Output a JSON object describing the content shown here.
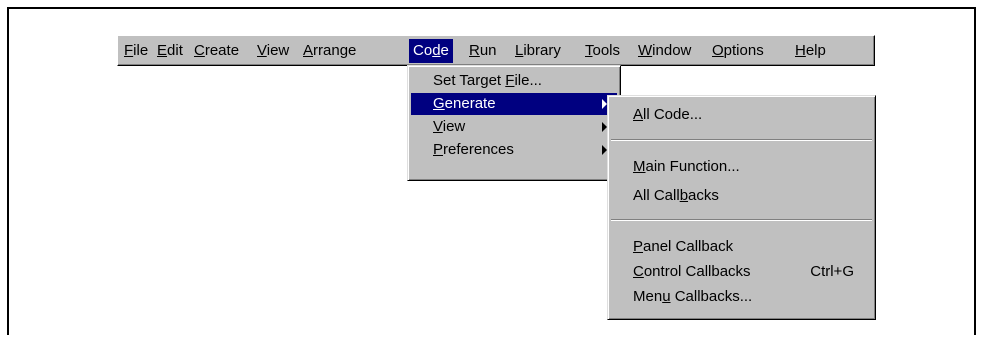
{
  "menubar": {
    "items": [
      {
        "pre": "",
        "acc": "F",
        "post": "ile"
      },
      {
        "pre": "",
        "acc": "E",
        "post": "dit"
      },
      {
        "pre": "",
        "acc": "C",
        "post": "reate"
      },
      {
        "pre": "",
        "acc": "V",
        "post": "iew"
      },
      {
        "pre": "",
        "acc": "A",
        "post": "rrange"
      },
      {
        "pre": "Co",
        "acc": "d",
        "post": "e"
      },
      {
        "pre": "",
        "acc": "R",
        "post": "un"
      },
      {
        "pre": "",
        "acc": "L",
        "post": "ibrary"
      },
      {
        "pre": "",
        "acc": "T",
        "post": "ools"
      },
      {
        "pre": "",
        "acc": "W",
        "post": "indow"
      },
      {
        "pre": "",
        "acc": "O",
        "post": "ptions"
      },
      {
        "pre": "",
        "acc": "H",
        "post": "elp"
      }
    ]
  },
  "code_menu": {
    "items": [
      {
        "pre": "Set Target ",
        "acc": "F",
        "post": "ile..."
      },
      {
        "pre": "",
        "acc": "G",
        "post": "enerate"
      },
      {
        "pre": "",
        "acc": "V",
        "post": "iew"
      },
      {
        "pre": "",
        "acc": "P",
        "post": "references"
      }
    ]
  },
  "generate_menu": {
    "all_code": {
      "pre": "",
      "acc": "A",
      "post": "ll Code..."
    },
    "main_function": {
      "pre": "",
      "acc": "M",
      "post": "ain Function..."
    },
    "all_callbacks": {
      "pre": "All Call",
      "acc": "b",
      "post": "acks"
    },
    "panel_callback": {
      "pre": "",
      "acc": "P",
      "post": "anel Callback"
    },
    "control_callbacks": {
      "pre": "",
      "acc": "C",
      "post": "ontrol Callbacks",
      "shortcut": "Ctrl+G"
    },
    "menu_callbacks": {
      "pre": "Men",
      "acc": "u",
      "post": " Callbacks..."
    }
  },
  "colors": {
    "menu_bg": "#c0c0c0",
    "highlight": "#000080",
    "highlight_text": "#ffffff"
  }
}
